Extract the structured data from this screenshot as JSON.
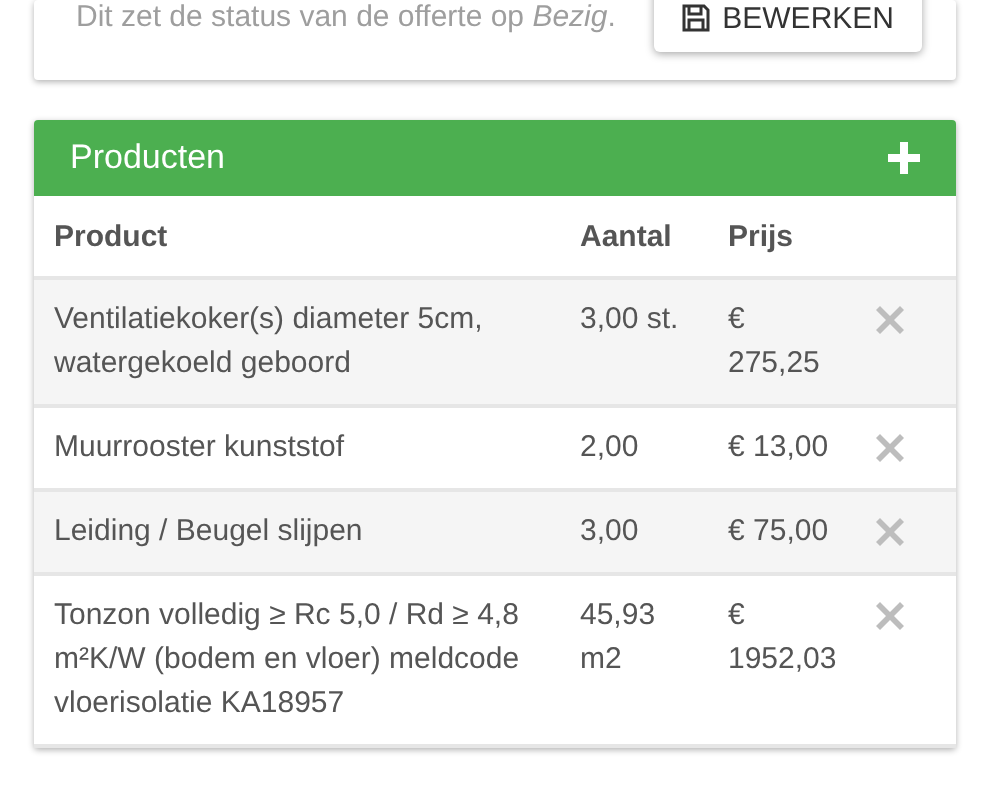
{
  "status_card": {
    "text": "Dit zet de status van de offerte op *Bezig*.",
    "button": "BEWERKEN"
  },
  "products": {
    "title": "Producten",
    "columns": [
      "Product",
      "Aantal",
      "Prijs"
    ],
    "rows": [
      {
        "product": "Ventilatiekoker(s) diameter 5cm, watergekoeld geboord",
        "quantity": "3,00 st.",
        "price": "€ 275,25"
      },
      {
        "product": "Muurrooster kunststof",
        "quantity": "2,00",
        "price": "€ 13,00"
      },
      {
        "product": "Leiding / Beugel slijpen",
        "quantity": "3,00",
        "price": "€ 75,00"
      },
      {
        "product": "Tonzon volledig ≥ Rc 5,0 / Rd ≥ 4,8 m²K/W (bodem en vloer) meldcode vloerisolatie KA18957",
        "quantity": "45,93 m2",
        "price": "€ 1952,03"
      }
    ]
  }
}
